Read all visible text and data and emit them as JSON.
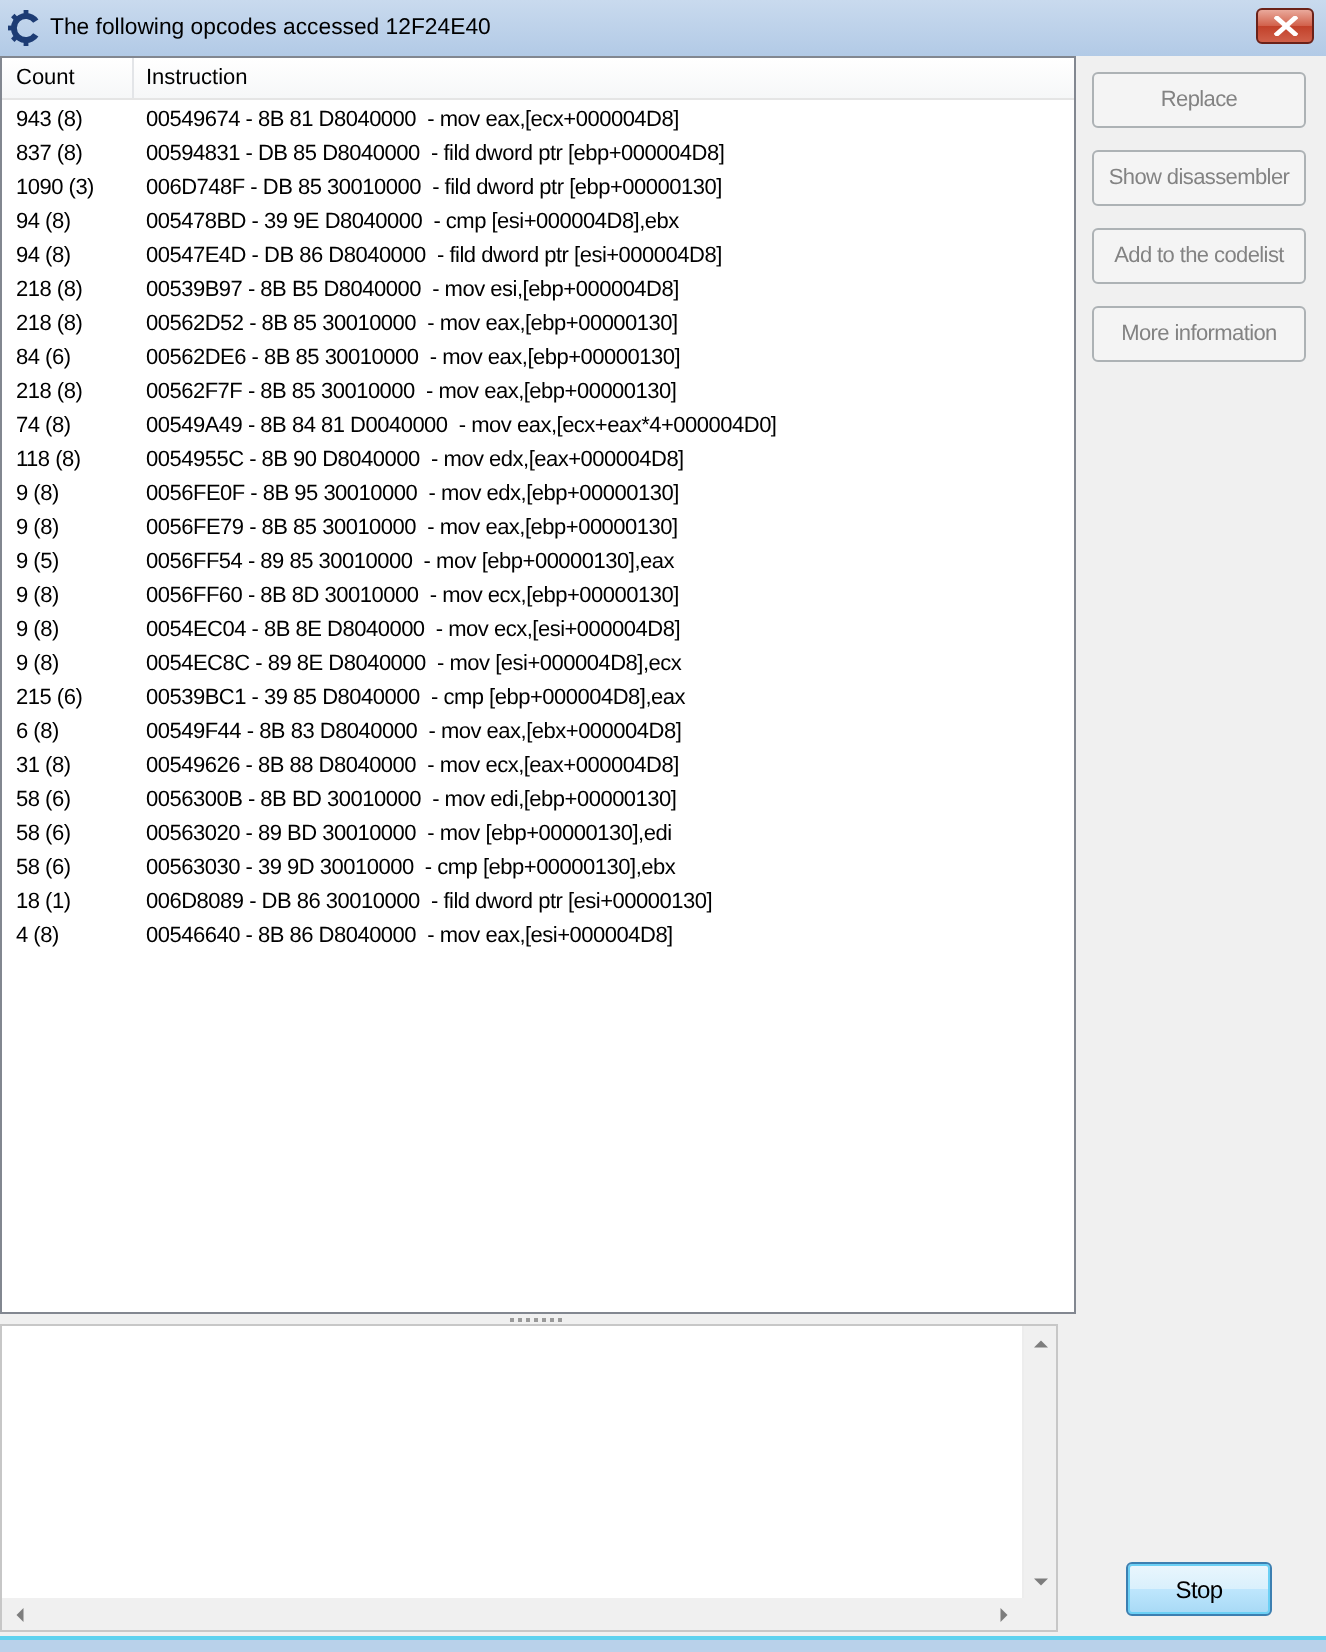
{
  "window": {
    "title": "The following opcodes accessed 12F24E40"
  },
  "list": {
    "columns": [
      "Count",
      "Instruction"
    ],
    "rows": [
      {
        "count": "943 (8)",
        "instruction": "00549674 - 8B 81 D8040000  - mov eax,[ecx+000004D8]",
        "selected": false
      },
      {
        "count": "837 (8)",
        "instruction": "00594831 - DB 85 D8040000  - fild dword ptr [ebp+000004D8]",
        "selected": false
      },
      {
        "count": "1090 (3)",
        "instruction": "006D748F - DB 85 30010000  - fild dword ptr [ebp+00000130]",
        "selected": false
      },
      {
        "count": "94 (8)",
        "instruction": "005478BD - 39 9E D8040000  - cmp [esi+000004D8],ebx",
        "selected": false
      },
      {
        "count": "94 (8)",
        "instruction": "00547E4D - DB 86 D8040000  - fild dword ptr [esi+000004D8]",
        "selected": false
      },
      {
        "count": "218 (8)",
        "instruction": "00539B97 - 8B B5 D8040000  - mov esi,[ebp+000004D8]",
        "selected": false
      },
      {
        "count": "218 (8)",
        "instruction": "00562D52 - 8B 85 30010000  - mov eax,[ebp+00000130]",
        "selected": false
      },
      {
        "count": "84 (6)",
        "instruction": "00562DE6 - 8B 85 30010000  - mov eax,[ebp+00000130]",
        "selected": false
      },
      {
        "count": "218 (8)",
        "instruction": "00562F7F - 8B 85 30010000  - mov eax,[ebp+00000130]",
        "selected": false
      },
      {
        "count": "74 (8)",
        "instruction": "00549A49 - 8B 84 81 D0040000  - mov eax,[ecx+eax*4+000004D0]",
        "selected": false
      },
      {
        "count": "118 (8)",
        "instruction": "0054955C - 8B 90 D8040000  - mov edx,[eax+000004D8]",
        "selected": false
      },
      {
        "count": "9 (8)",
        "instruction": "0056FE0F - 8B 95 30010000  - mov edx,[ebp+00000130]",
        "selected": false
      },
      {
        "count": "9 (8)",
        "instruction": "0056FE79 - 8B 85 30010000  - mov eax,[ebp+00000130]",
        "selected": false
      },
      {
        "count": "9 (5)",
        "instruction": "0056FF54 - 89 85 30010000  - mov [ebp+00000130],eax",
        "selected": false
      },
      {
        "count": "9 (8)",
        "instruction": "0056FF60 - 8B 8D 30010000  - mov ecx,[ebp+00000130]",
        "selected": false
      },
      {
        "count": "9 (8)",
        "instruction": "0054EC04 - 8B 8E D8040000  - mov ecx,[esi+000004D8]",
        "selected": false
      },
      {
        "count": "9 (8)",
        "instruction": "0054EC8C - 89 8E D8040000  - mov [esi+000004D8],ecx",
        "selected": false
      },
      {
        "count": "215 (6)",
        "instruction": "00539BC1 - 39 85 D8040000  - cmp [ebp+000004D8],eax",
        "selected": false
      },
      {
        "count": "6 (8)",
        "instruction": "00549F44 - 8B 83 D8040000  - mov eax,[ebx+000004D8]",
        "selected": false
      },
      {
        "count": "31 (8)",
        "instruction": "00549626 - 8B 88 D8040000  - mov ecx,[eax+000004D8]",
        "selected": false
      },
      {
        "count": "58 (6)",
        "instruction": "0056300B - 8B BD 30010000  - mov edi,[ebp+00000130]",
        "selected": false
      },
      {
        "count": "58 (6)",
        "instruction": "00563020 - 89 BD 30010000  - mov [ebp+00000130],edi",
        "selected": false
      },
      {
        "count": "58 (6)",
        "instruction": "00563030 - 39 9D 30010000  - cmp [ebp+00000130],ebx",
        "selected": false
      },
      {
        "count": "18 (1)",
        "instruction": "006D8089 - DB 86 30010000  - fild dword ptr [esi+00000130]",
        "selected": false
      },
      {
        "count": "4 (8)",
        "instruction": "00546640 - 8B 86 D8040000  - mov eax,[esi+000004D8]",
        "selected": false
      }
    ]
  },
  "action_buttons": [
    {
      "label": "Replace",
      "disabled": true
    },
    {
      "label": "Show disassembler",
      "disabled": true
    },
    {
      "label": "Add to the codelist",
      "disabled": true
    },
    {
      "label": "More information",
      "disabled": true
    }
  ],
  "stop_button": {
    "label": "Stop",
    "focused": true
  }
}
